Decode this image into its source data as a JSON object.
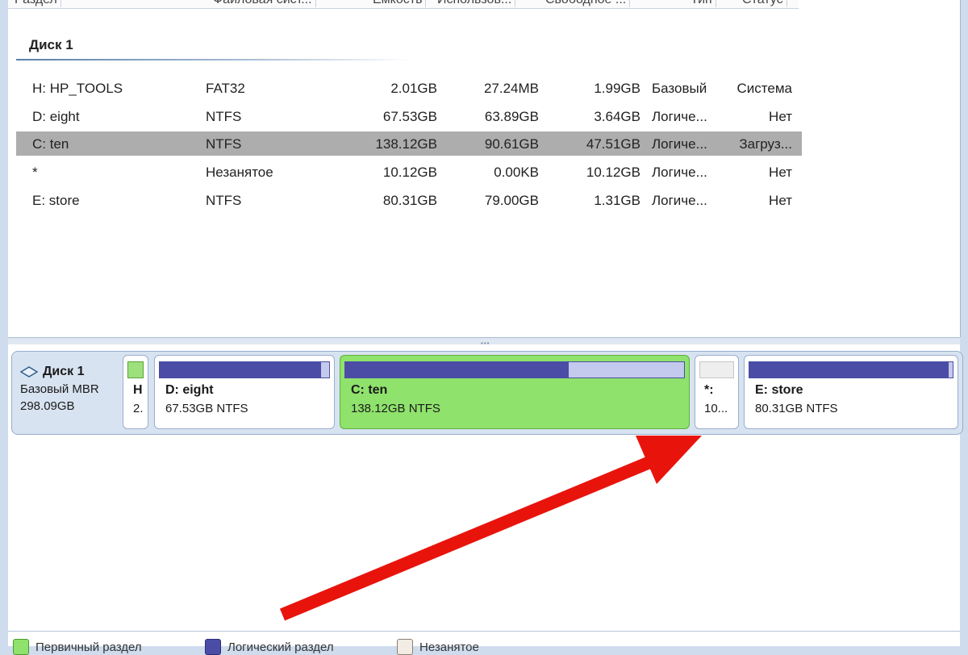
{
  "columns": [
    "Раздел",
    "Файловая сист...",
    "Ёмкость",
    "Использов...",
    "Свободное ...",
    "Тип",
    "Статус"
  ],
  "disk_group": {
    "title": "Диск 1"
  },
  "partitions": [
    {
      "name": "H: HP_TOOLS",
      "fs": "FAT32",
      "capacity": "2.01GB",
      "used": "27.24MB",
      "free": "1.99GB",
      "type": "Базовый",
      "status": "Система",
      "selected": false
    },
    {
      "name": "D: eight",
      "fs": "NTFS",
      "capacity": "67.53GB",
      "used": "63.89GB",
      "free": "3.64GB",
      "type": "Логиче...",
      "status": "Нет",
      "selected": false
    },
    {
      "name": "C: ten",
      "fs": "NTFS",
      "capacity": "138.12GB",
      "used": "90.61GB",
      "free": "47.51GB",
      "type": "Логиче...",
      "status": "Загруз...",
      "selected": true
    },
    {
      "name": "*",
      "fs": "Незанятое",
      "capacity": "10.12GB",
      "used": "0.00KB",
      "free": "10.12GB",
      "type": "Логиче...",
      "status": "Нет",
      "selected": false
    },
    {
      "name": "E: store",
      "fs": "NTFS",
      "capacity": "80.31GB",
      "used": "79.00GB",
      "free": "1.31GB",
      "type": "Логиче...",
      "status": "Нет",
      "selected": false
    }
  ],
  "disk_map": {
    "title": "Диск 1",
    "kind": "Базовый MBR",
    "size": "298.09GB",
    "blocks": [
      {
        "label": "H",
        "sub": "2.",
        "used_fraction": 1.0,
        "style": "primary-small"
      },
      {
        "label": "D: eight",
        "sub": "67.53GB NTFS",
        "used_fraction": 0.95
      },
      {
        "label": "C: ten",
        "sub": "138.12GB NTFS",
        "used_fraction": 0.66
      },
      {
        "label": "*:",
        "sub": "10...",
        "used_fraction": 0.0
      },
      {
        "label": "E: store",
        "sub": "80.31GB NTFS",
        "used_fraction": 0.98
      }
    ]
  },
  "legend": [
    "Первичный раздел",
    "Логический раздел",
    "Незанятое"
  ],
  "colors": {
    "primary": "#8fe26c",
    "logical": "#4a4ca6",
    "unallocated": "#eeeeee",
    "selected_row": "#adadad",
    "arrow": "#e8140c"
  }
}
